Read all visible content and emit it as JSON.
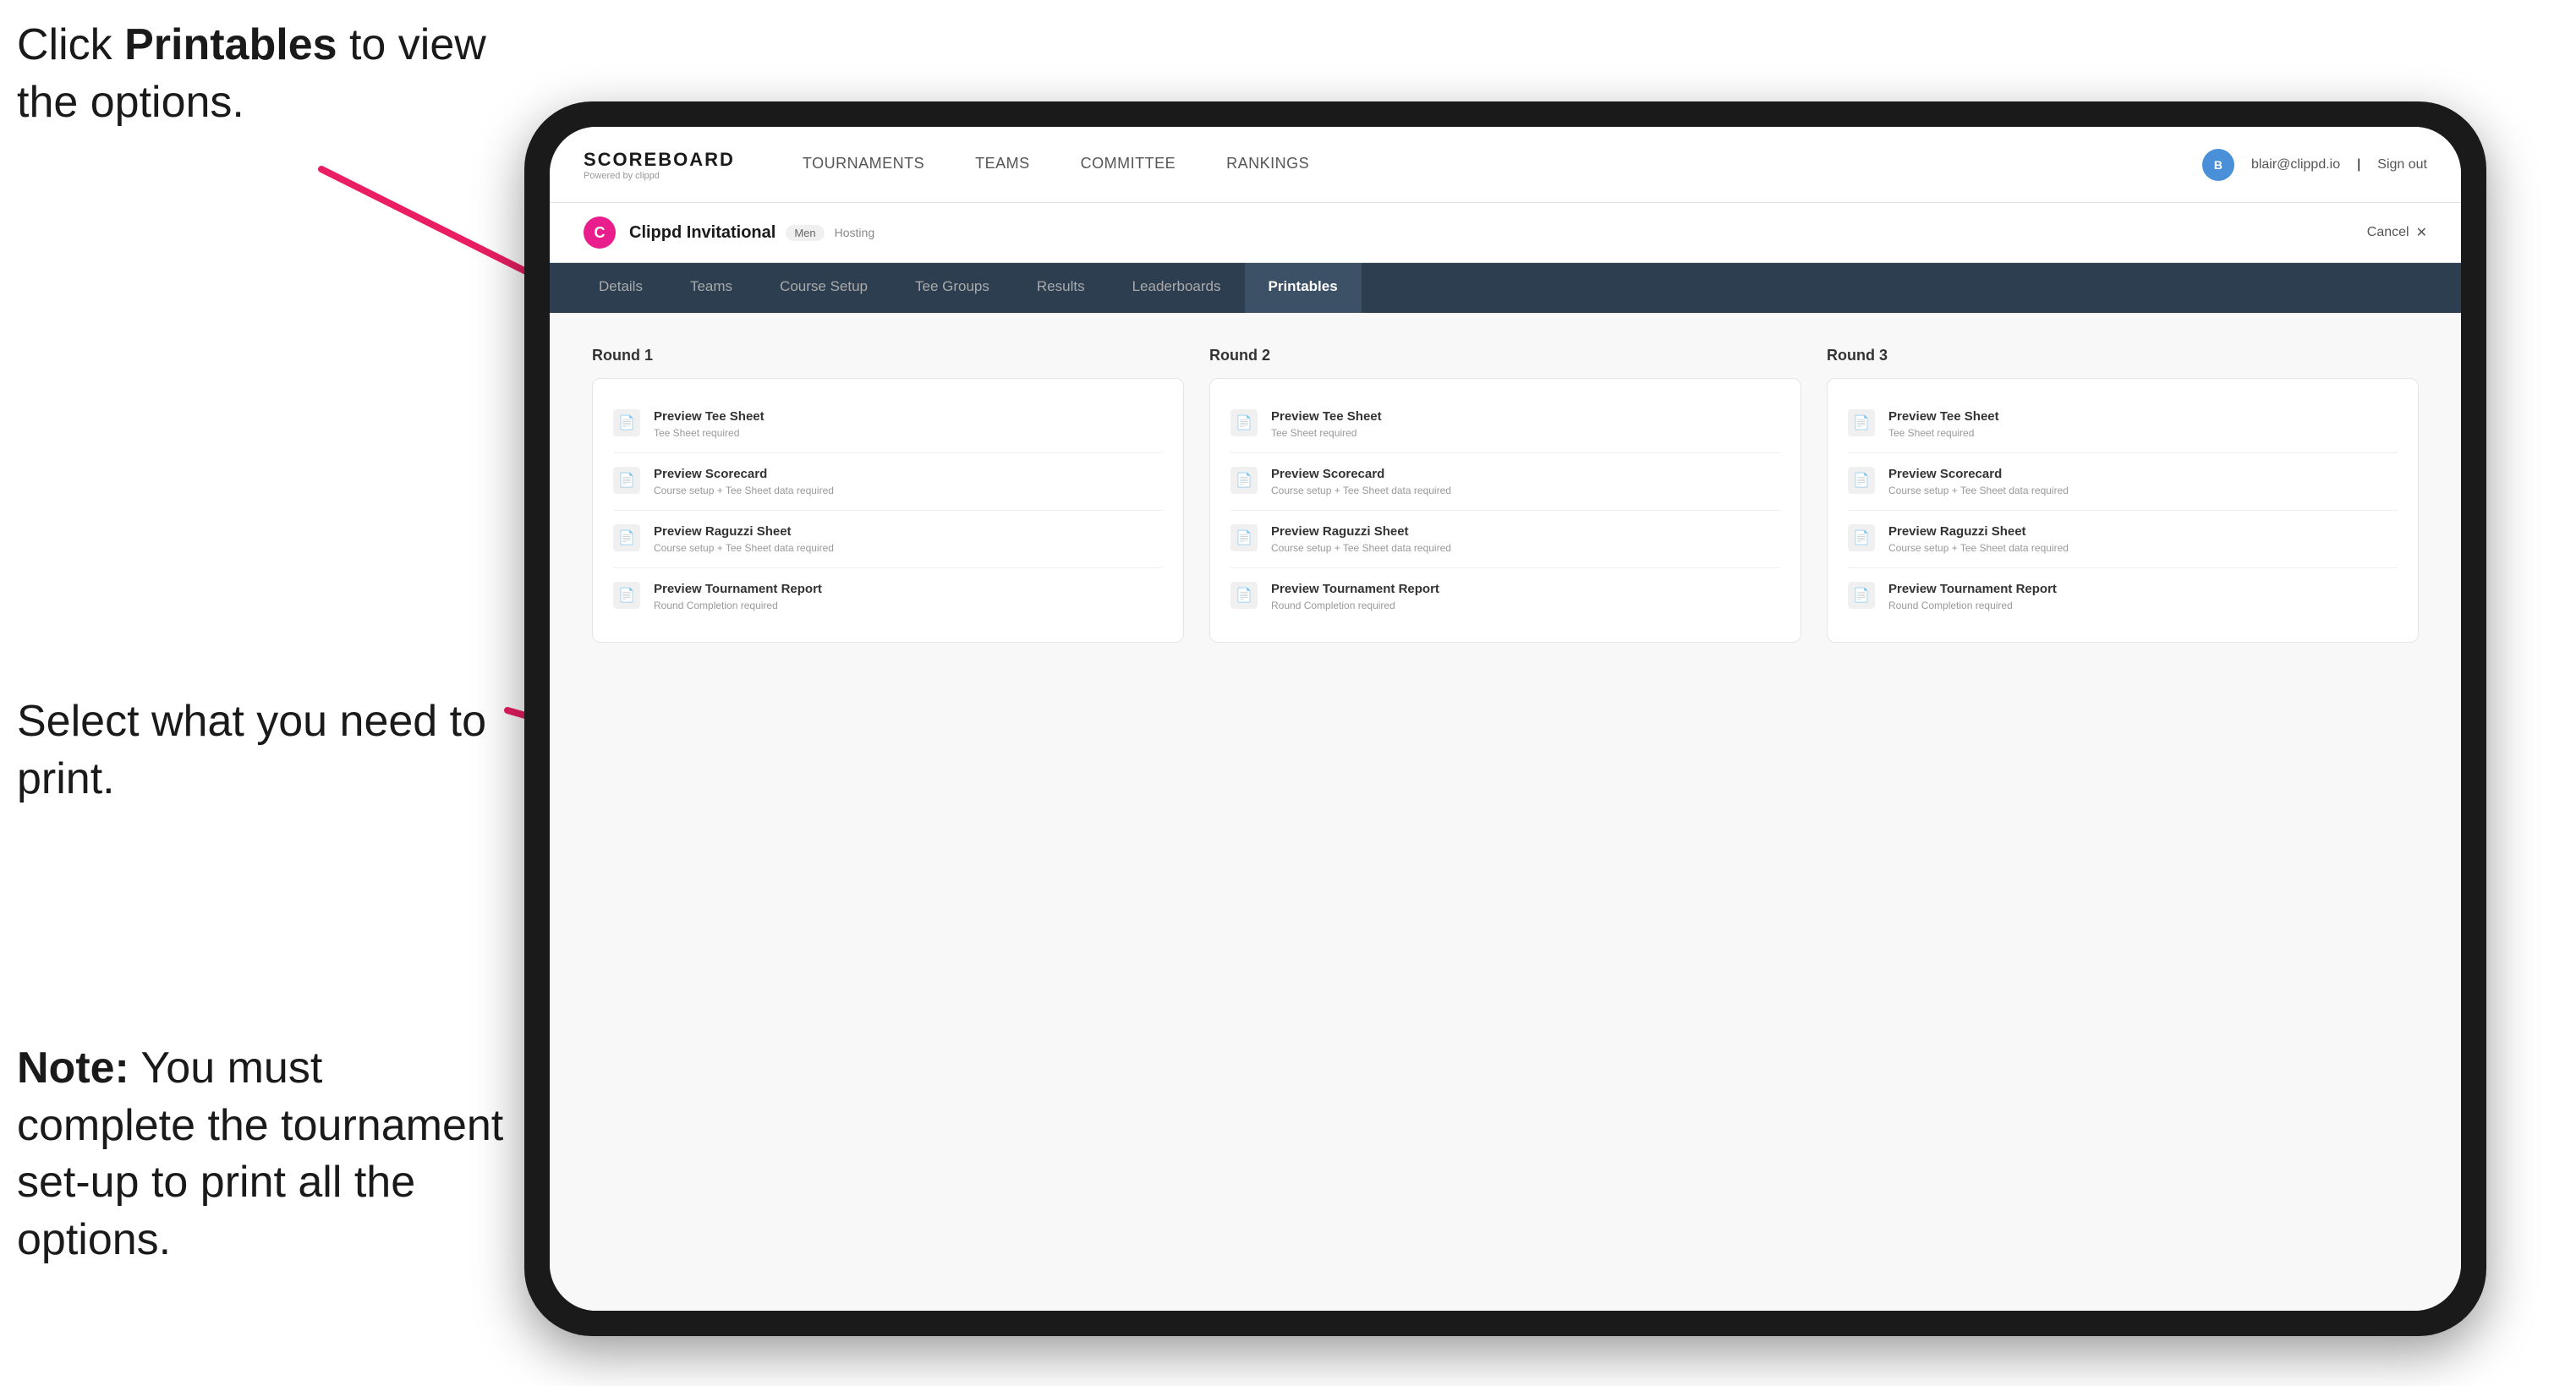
{
  "annotations": {
    "top": {
      "line1": "Click ",
      "bold": "Printables",
      "line2": " to",
      "line3": "view the options."
    },
    "middle": {
      "text": "Select what you need to print."
    },
    "bottom": {
      "bold": "Note:",
      "text": " You must complete the tournament set-up to print all the options."
    }
  },
  "topNav": {
    "logo": {
      "title": "SCOREBOARD",
      "sub": "Powered by clippd"
    },
    "links": [
      {
        "label": "TOURNAMENTS",
        "active": false
      },
      {
        "label": "TEAMS",
        "active": false
      },
      {
        "label": "COMMITTEE",
        "active": false
      },
      {
        "label": "RANKINGS",
        "active": false
      }
    ],
    "user": {
      "email": "blair@clippd.io",
      "separator": "|",
      "signOut": "Sign out"
    }
  },
  "tournament": {
    "logoLetter": "C",
    "name": "Clippd Invitational",
    "badge": "Men",
    "status": "Hosting",
    "cancel": "Cancel",
    "cancelIcon": "✕"
  },
  "subNav": {
    "tabs": [
      {
        "label": "Details",
        "active": false
      },
      {
        "label": "Teams",
        "active": false
      },
      {
        "label": "Course Setup",
        "active": false
      },
      {
        "label": "Tee Groups",
        "active": false
      },
      {
        "label": "Results",
        "active": false
      },
      {
        "label": "Leaderboards",
        "active": false
      },
      {
        "label": "Printables",
        "active": true
      }
    ]
  },
  "rounds": [
    {
      "title": "Round 1",
      "items": [
        {
          "title": "Preview Tee Sheet",
          "sub": "Tee Sheet required"
        },
        {
          "title": "Preview Scorecard",
          "sub": "Course setup + Tee Sheet data required"
        },
        {
          "title": "Preview Raguzzi Sheet",
          "sub": "Course setup + Tee Sheet data required"
        },
        {
          "title": "Preview Tournament Report",
          "sub": "Round Completion required"
        }
      ]
    },
    {
      "title": "Round 2",
      "items": [
        {
          "title": "Preview Tee Sheet",
          "sub": "Tee Sheet required"
        },
        {
          "title": "Preview Scorecard",
          "sub": "Course setup + Tee Sheet data required"
        },
        {
          "title": "Preview Raguzzi Sheet",
          "sub": "Course setup + Tee Sheet data required"
        },
        {
          "title": "Preview Tournament Report",
          "sub": "Round Completion required"
        }
      ]
    },
    {
      "title": "Round 3",
      "items": [
        {
          "title": "Preview Tee Sheet",
          "sub": "Tee Sheet required"
        },
        {
          "title": "Preview Scorecard",
          "sub": "Course setup + Tee Sheet data required"
        },
        {
          "title": "Preview Raguzzi Sheet",
          "sub": "Course setup + Tee Sheet data required"
        },
        {
          "title": "Preview Tournament Report",
          "sub": "Round Completion required"
        }
      ]
    }
  ]
}
